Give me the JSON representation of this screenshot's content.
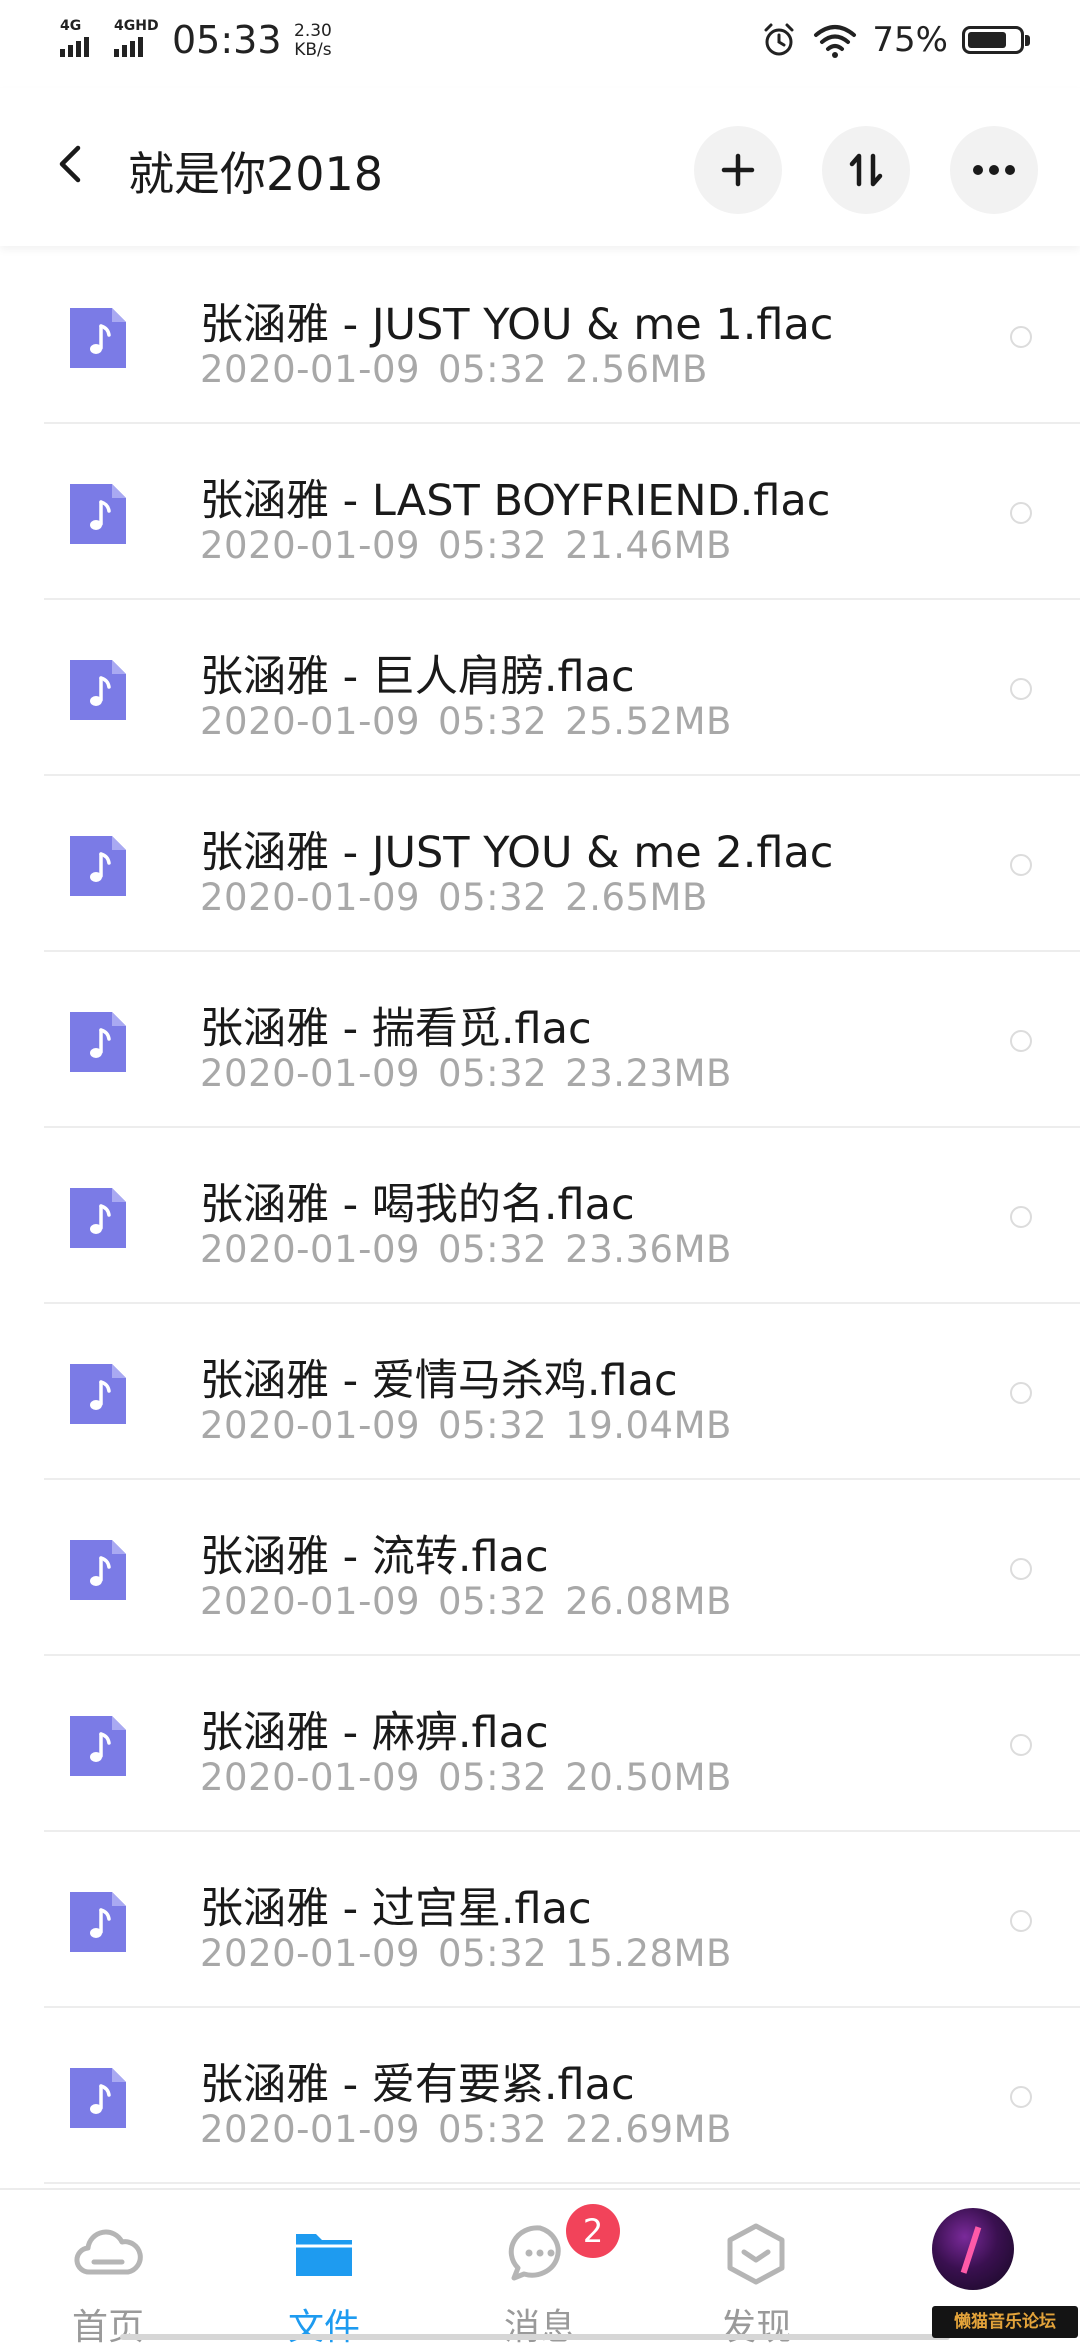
{
  "status_bar": {
    "signal1_label": "4G",
    "signal2_label": "4GHD",
    "time": "05:33",
    "speed_value": "2.30",
    "speed_unit": "KB/s",
    "battery_percent": "75%",
    "battery_level": 0.75
  },
  "header": {
    "title": "就是你2018",
    "back_icon": "chevron-left-icon",
    "add_icon": "plus-icon",
    "sort_icon": "sort-icon",
    "more_icon": "more-horizontal-icon"
  },
  "files": [
    {
      "name": "张涵雅 - JUST YOU & me 1.flac",
      "date": "2020-01-09",
      "time": "05:32",
      "size": "2.56MB"
    },
    {
      "name": "张涵雅 - LAST BOYFRIEND.flac",
      "date": "2020-01-09",
      "time": "05:32",
      "size": "21.46MB"
    },
    {
      "name": "张涵雅 - 巨人肩膀.flac",
      "date": "2020-01-09",
      "time": "05:32",
      "size": "25.52MB"
    },
    {
      "name": "张涵雅 - JUST YOU & me 2.flac",
      "date": "2020-01-09",
      "time": "05:32",
      "size": "2.65MB"
    },
    {
      "name": "张涵雅 - 揣看觅.flac",
      "date": "2020-01-09",
      "time": "05:32",
      "size": "23.23MB"
    },
    {
      "name": "张涵雅 - 喝我的名.flac",
      "date": "2020-01-09",
      "time": "05:32",
      "size": "23.36MB"
    },
    {
      "name": "张涵雅 - 爱情马杀鸡.flac",
      "date": "2020-01-09",
      "time": "05:32",
      "size": "19.04MB"
    },
    {
      "name": "张涵雅 - 流转.flac",
      "date": "2020-01-09",
      "time": "05:32",
      "size": "26.08MB"
    },
    {
      "name": "张涵雅 - 麻痹.flac",
      "date": "2020-01-09",
      "time": "05:32",
      "size": "20.50MB"
    },
    {
      "name": "张涵雅 - 过宫星.flac",
      "date": "2020-01-09",
      "time": "05:32",
      "size": "15.28MB"
    },
    {
      "name": "张涵雅 - 爱有要紧.flac",
      "date": "2020-01-09",
      "time": "05:32",
      "size": "22.69MB"
    }
  ],
  "bottom_nav": {
    "tabs": [
      {
        "label": "首页",
        "icon": "cloud-icon"
      },
      {
        "label": "文件",
        "icon": "folder-icon"
      },
      {
        "label": "消息",
        "icon": "chat-icon"
      },
      {
        "label": "发现",
        "icon": "discover-icon"
      }
    ],
    "active_tab": "文件",
    "message_badge": "2"
  },
  "watermark": "懒猫音乐论坛",
  "colors": {
    "accent": "#1e9bf0",
    "file_icon": "#7b7be6",
    "badge": "#f2435a",
    "meta_text": "#a8a8a8"
  }
}
